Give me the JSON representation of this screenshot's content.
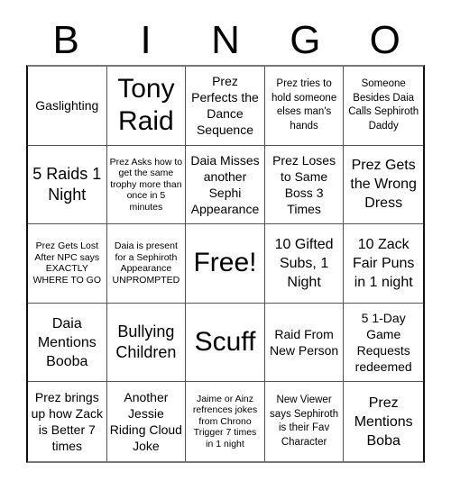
{
  "header": [
    "B",
    "I",
    "N",
    "G",
    "O"
  ],
  "cells": [
    {
      "text": "Gaslighting",
      "size": "s-md"
    },
    {
      "text": "Tony Raid",
      "size": "s-big"
    },
    {
      "text": "Prez Perfects the Dance Sequence",
      "size": "s-md"
    },
    {
      "text": "Prez tries to hold someone elses man's hands",
      "size": "s-sm"
    },
    {
      "text": "Someone Besides Daia Calls Sephiroth Daddy",
      "size": "s-sm"
    },
    {
      "text": "5 Raids 1 Night",
      "size": "s-xl"
    },
    {
      "text": "Prez Asks how to get the same trophy more than once in 5 minutes",
      "size": "s-xs"
    },
    {
      "text": "Daia Misses another Sephi Appearance",
      "size": "s-md"
    },
    {
      "text": "Prez Loses to Same Boss 3 Times",
      "size": "s-md"
    },
    {
      "text": "Prez Gets the Wrong Dress",
      "size": "s-lg"
    },
    {
      "text": "Prez Gets Lost After NPC says EXACTLY WHERE TO GO",
      "size": "s-xs"
    },
    {
      "text": "Daia is present for a Sephiroth Appearance UNPROMPTED",
      "size": "s-xs"
    },
    {
      "text": "Free!",
      "size": "s-big"
    },
    {
      "text": "10 Gifted Subs, 1 Night",
      "size": "s-lg"
    },
    {
      "text": "10 Zack Fair Puns in 1 night",
      "size": "s-lg"
    },
    {
      "text": "Daia Mentions Booba",
      "size": "s-lg"
    },
    {
      "text": "Bullying Children",
      "size": "s-xl"
    },
    {
      "text": "Scuff",
      "size": "s-big"
    },
    {
      "text": "Raid From New Person",
      "size": "s-md"
    },
    {
      "text": "5 1-Day Game Requests redeemed",
      "size": "s-md"
    },
    {
      "text": "Prez brings up how Zack is Better 7 times",
      "size": "s-md"
    },
    {
      "text": "Another Jessie Riding Cloud Joke",
      "size": "s-md"
    },
    {
      "text": "Jaime or Ainz refrences jokes from Chrono Trigger 7 times in 1 night",
      "size": "s-xs"
    },
    {
      "text": "New Viewer says Sephiroth is their Fav Character",
      "size": "s-sm"
    },
    {
      "text": "Prez Mentions Boba",
      "size": "s-lg"
    }
  ]
}
